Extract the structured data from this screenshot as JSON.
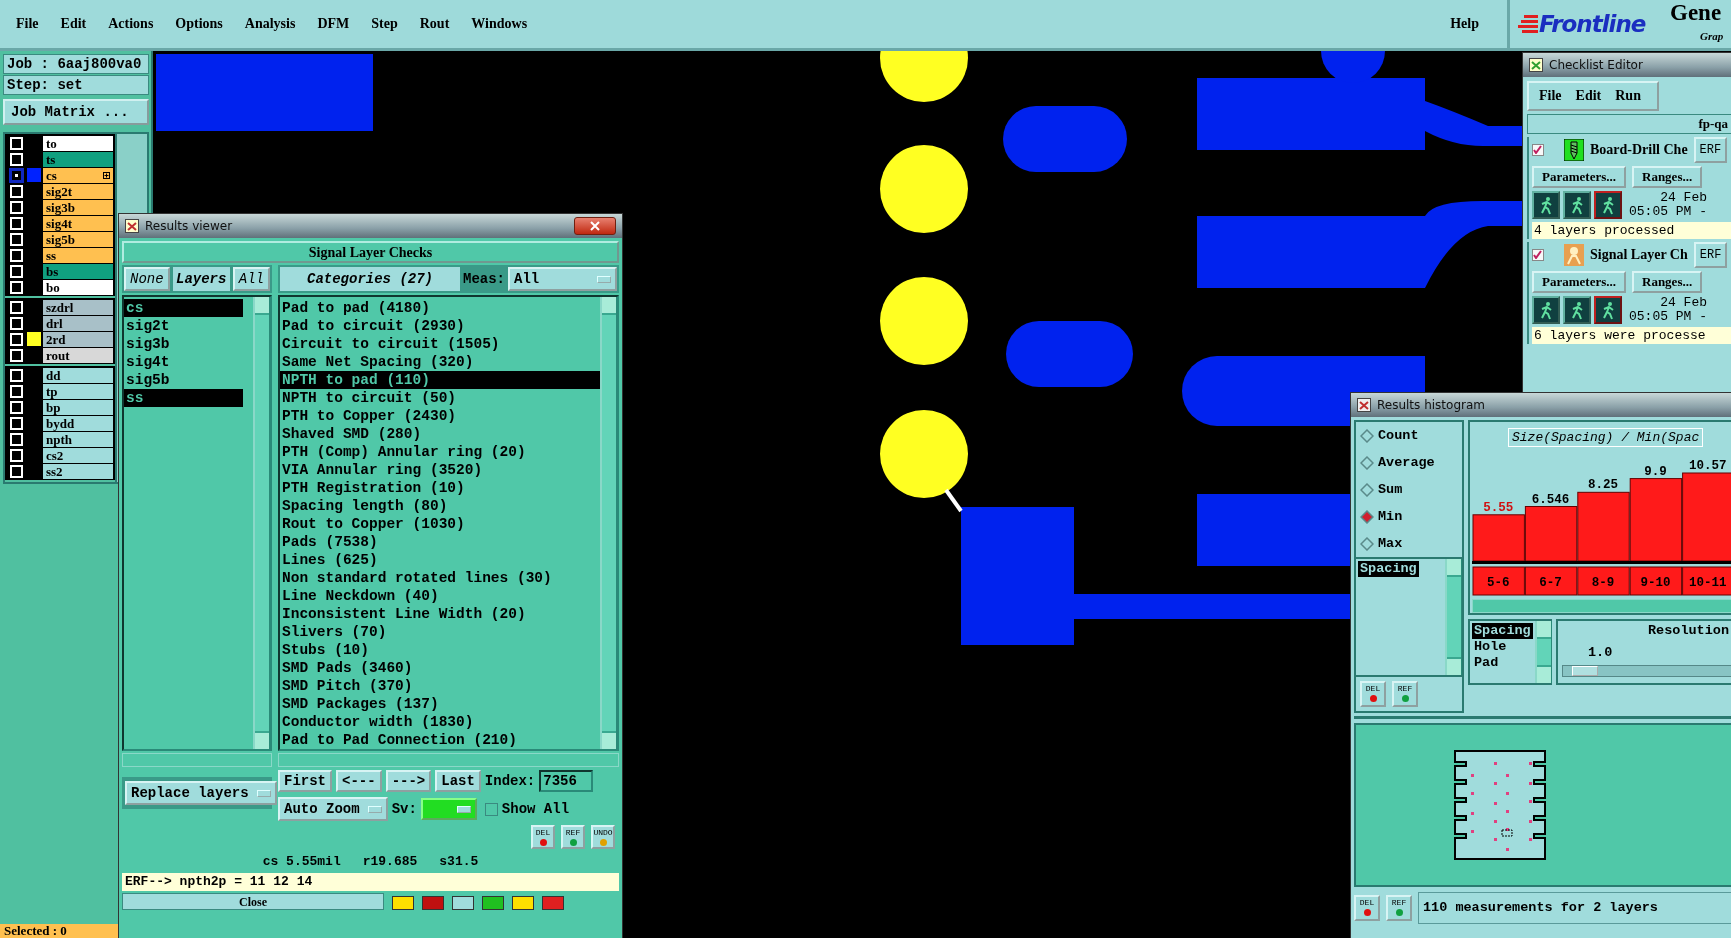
{
  "menu_bar": {
    "items": [
      "File",
      "Edit",
      "Actions",
      "Options",
      "Analysis",
      "DFM",
      "Step",
      "Rout",
      "Windows"
    ],
    "help": "Help"
  },
  "logo": {
    "brand": "Frontline",
    "product": "Gene",
    "subtitle": "Grap"
  },
  "job_panel": {
    "job": "Job : 6aaj800va0",
    "step": "Step: set",
    "matrix_button": "Job Matrix ...",
    "layer_groups": [
      [
        {
          "name": "to",
          "kind": "silk",
          "selected": false
        },
        {
          "name": "ts",
          "kind": "mask",
          "selected": false
        },
        {
          "name": "cs",
          "kind": "signal",
          "selected": true,
          "color": "#0022ff"
        },
        {
          "name": "sig2t",
          "kind": "signal",
          "selected": false
        },
        {
          "name": "sig3b",
          "kind": "signal",
          "selected": false
        },
        {
          "name": "sig4t",
          "kind": "signal",
          "selected": false
        },
        {
          "name": "sig5b",
          "kind": "signal",
          "selected": false
        },
        {
          "name": "ss",
          "kind": "signal",
          "selected": false
        },
        {
          "name": "bs",
          "kind": "mask",
          "selected": false
        },
        {
          "name": "bo",
          "kind": "silk",
          "selected": false
        }
      ],
      [
        {
          "name": "szdrl",
          "kind": "drill",
          "selected": false
        },
        {
          "name": "drl",
          "kind": "drill",
          "selected": false
        },
        {
          "name": "2rd",
          "kind": "drill",
          "selected": false,
          "color": "#ffff22"
        },
        {
          "name": "rout",
          "kind": "rout",
          "selected": false
        }
      ],
      [
        {
          "name": "dd",
          "kind": "doc",
          "selected": false
        },
        {
          "name": "tp",
          "kind": "doc",
          "selected": false
        },
        {
          "name": "bp",
          "kind": "doc",
          "selected": false
        },
        {
          "name": "bydd",
          "kind": "doc",
          "selected": false
        },
        {
          "name": "npth",
          "kind": "doc",
          "selected": false
        },
        {
          "name": "cs2",
          "kind": "doc",
          "selected": false
        },
        {
          "name": "ss2",
          "kind": "doc",
          "selected": false
        }
      ]
    ],
    "selected_count": "Selected : 0"
  },
  "results_viewer": {
    "title": "Results viewer",
    "header": "Signal Layer Checks",
    "none_button": "None",
    "layers_header": "Layers",
    "all_button": "All",
    "layers": [
      {
        "name": "cs",
        "selected": true
      },
      {
        "name": "sig2t",
        "selected": false
      },
      {
        "name": "sig3b",
        "selected": false
      },
      {
        "name": "sig4t",
        "selected": false
      },
      {
        "name": "sig5b",
        "selected": false
      },
      {
        "name": "ss",
        "selected": true
      }
    ],
    "categories_header": "Categories (27)",
    "meas_label": "Meas:",
    "meas_value": "All",
    "categories": [
      {
        "label": "Pad to pad (4180)",
        "selected": false
      },
      {
        "label": "Pad to circuit (2930)",
        "selected": false
      },
      {
        "label": "Circuit to circuit (1505)",
        "selected": false
      },
      {
        "label": "Same Net Spacing (320)",
        "selected": false
      },
      {
        "label": "NPTH to pad (110)",
        "selected": true
      },
      {
        "label": "NPTH to circuit (50)",
        "selected": false
      },
      {
        "label": "PTH to Copper (2430)",
        "selected": false
      },
      {
        "label": "Shaved SMD (280)",
        "selected": false
      },
      {
        "label": "PTH (Comp) Annular ring (20)",
        "selected": false
      },
      {
        "label": "VIA Annular ring (3520)",
        "selected": false
      },
      {
        "label": "PTH Registration (10)",
        "selected": false
      },
      {
        "label": "Spacing length (80)",
        "selected": false
      },
      {
        "label": "Rout to Copper (1030)",
        "selected": false
      },
      {
        "label": "Pads (7538)",
        "selected": false
      },
      {
        "label": "Lines (625)",
        "selected": false
      },
      {
        "label": "Non standard rotated lines (30)",
        "selected": false
      },
      {
        "label": "Line Neckdown (40)",
        "selected": false
      },
      {
        "label": "Inconsistent Line Width (20)",
        "selected": false
      },
      {
        "label": "Slivers (70)",
        "selected": false
      },
      {
        "label": "Stubs (10)",
        "selected": false
      },
      {
        "label": "SMD Pads (3460)",
        "selected": false
      },
      {
        "label": "SMD Pitch (370)",
        "selected": false
      },
      {
        "label": "SMD Packages (137)",
        "selected": false
      },
      {
        "label": "Conductor width (1830)",
        "selected": false
      },
      {
        "label": "Pad to Pad Connection (210)",
        "selected": false
      }
    ],
    "nav_buttons": [
      "First",
      "<---",
      "--->",
      "Last"
    ],
    "index_label": "Index:",
    "index_value": "7356",
    "zoom_mode": "Auto Zoom",
    "sv_label": "Sv:",
    "show_all": {
      "label": "Show All",
      "checked": false
    },
    "replace_button": "Replace layers",
    "tool_buttons": [
      {
        "label": "DEL",
        "kind": "delete"
      },
      {
        "label": "REF",
        "kind": "refresh"
      },
      {
        "label": "UNDO",
        "kind": "undo"
      }
    ],
    "status": [
      "cs 5.55mil",
      "r19.685",
      "s31.5"
    ],
    "erf_line": "ERF--> npth2p = 11 12 14",
    "close_button": "Close"
  },
  "checklist_editor": {
    "title": "Checklist Editor",
    "menu": [
      "File",
      "Edit",
      "Run"
    ],
    "checklist_name": "fp-qa",
    "checks": [
      {
        "kind": "drill",
        "name": "Board-Drill Che",
        "checked": true,
        "erf": "ERF",
        "parameters": "Parameters...",
        "ranges": "Ranges...",
        "date": "24 Feb",
        "time": "05:05 PM -",
        "message": "4 layers processed"
      },
      {
        "kind": "signal",
        "name": "Signal Layer Ch",
        "checked": true,
        "erf": "ERF",
        "parameters": "Parameters...",
        "ranges": "Ranges...",
        "date": "24 Feb",
        "time": "05:05 PM -",
        "message": "6 layers were processe"
      }
    ]
  },
  "results_histogram": {
    "title": "Results histogram",
    "stats": [
      {
        "label": "Count",
        "selected": false
      },
      {
        "label": "Average",
        "selected": false
      },
      {
        "label": "Sum",
        "selected": false
      },
      {
        "label": "Min",
        "selected": true
      },
      {
        "label": "Max",
        "selected": false
      }
    ],
    "measures": [
      {
        "label": "Spacing",
        "selected": true
      }
    ],
    "chart_title": "Size(Spacing) / Min(Spac",
    "chart_data": {
      "type": "bar",
      "categories": [
        "5-6",
        "6-7",
        "8-9",
        "9-10",
        "10-11"
      ],
      "series": [
        {
          "color": "#ff1a1a",
          "values": [
            5.55,
            6.546,
            8.25,
            9.9,
            10.57
          ]
        }
      ],
      "data_labels": true
    },
    "types": [
      {
        "label": "Spacing",
        "selected": true
      },
      {
        "label": "Hole",
        "selected": false
      },
      {
        "label": "Pad",
        "selected": false
      }
    ],
    "resolution_label": "Resolution",
    "resolution_value": "1.0",
    "resolution": {
      "level": 0.05
    },
    "buttons": [
      {
        "label": "DEL",
        "kind": "delete"
      },
      {
        "label": "REF",
        "kind": "refresh"
      }
    ],
    "bottom_buttons": [
      {
        "label": "DEL",
        "kind": "delete"
      },
      {
        "label": "REF",
        "kind": "refresh"
      }
    ],
    "summary": "110 measurements for 2 layers"
  }
}
